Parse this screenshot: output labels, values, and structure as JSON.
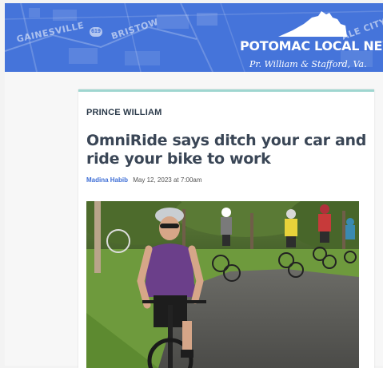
{
  "header": {
    "brand_title": "POTOMAC LOCAL NEWS",
    "brand_subtitle": "Pr. William & Stafford, Va.",
    "map_labels": {
      "gainesville": "GAINESVILLE",
      "bristow": "BRISTOW",
      "city": "ALE CITY"
    },
    "route_badge": "619",
    "background_color": "#3f6fd6"
  },
  "article": {
    "category": "PRINCE WILLIAM",
    "headline": "OmniRide says ditch your car and ride your bike to work",
    "author": "Madina Habib",
    "date": "May 12, 2023 at 7:00am",
    "accent_color": "#9fd6d0",
    "photo_icon": "cyclists-photo"
  }
}
